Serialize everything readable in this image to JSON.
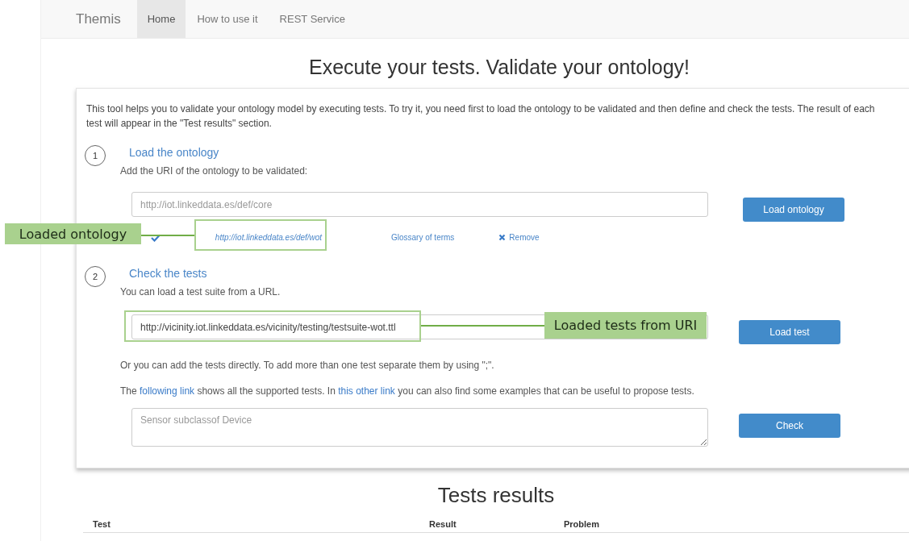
{
  "navbar": {
    "brand": "Themis",
    "tabs": [
      {
        "label": "Home",
        "selected": true
      },
      {
        "label": "How to use it",
        "selected": false
      },
      {
        "label": "REST Service",
        "selected": false
      }
    ]
  },
  "title": "Execute your tests. Validate your ontology!",
  "intro": "This tool helps you to validate your ontology model by executing tests. To try it, you need first to load the ontology to be validated and then define and check the tests. The result of each test will appear in the \"Test results\" section.",
  "steps": [
    {
      "number": "1",
      "heading": "Load the ontology",
      "hint": "Add the URI of the ontology to be validated:",
      "field": {
        "kind": "input",
        "placeholder": "http://iot.linkeddata.es/def/core"
      },
      "button": "Load ontology",
      "loaded": {
        "uri": "http://iot.linkeddata.es/def/wot",
        "glossary": "Glossary of terms",
        "remove": "Remove"
      }
    },
    {
      "number": "2",
      "heading": "Check the tests",
      "hint": "You can load a test suite from a URL.",
      "field": {
        "kind": "input",
        "value": "http://vicinity.iot.linkeddata.es/vicinity/testing/testsuite-wot.ttl"
      },
      "button": "Load test",
      "paragraphs": [
        [
          {
            "text": "Or you can add the tests directly. To add more than one test separate them by using \";\"."
          }
        ],
        [
          {
            "text": "The "
          },
          {
            "link": "following link"
          },
          {
            "text": " shows all the supported tests. In "
          },
          {
            "link": "this other link"
          },
          {
            "text": " you can also find some examples that can be useful to propose tests."
          }
        ]
      ],
      "tests": {
        "kind": "textarea",
        "placeholder": "Sensor subclassof Device"
      },
      "check_button": "Check"
    }
  ],
  "results": {
    "title": "Tests results",
    "columns": [
      "Test",
      "Result",
      "Problem"
    ]
  },
  "callouts": [
    {
      "text": "Loaded ontology"
    },
    {
      "text": "Loaded tests from URI"
    }
  ]
}
